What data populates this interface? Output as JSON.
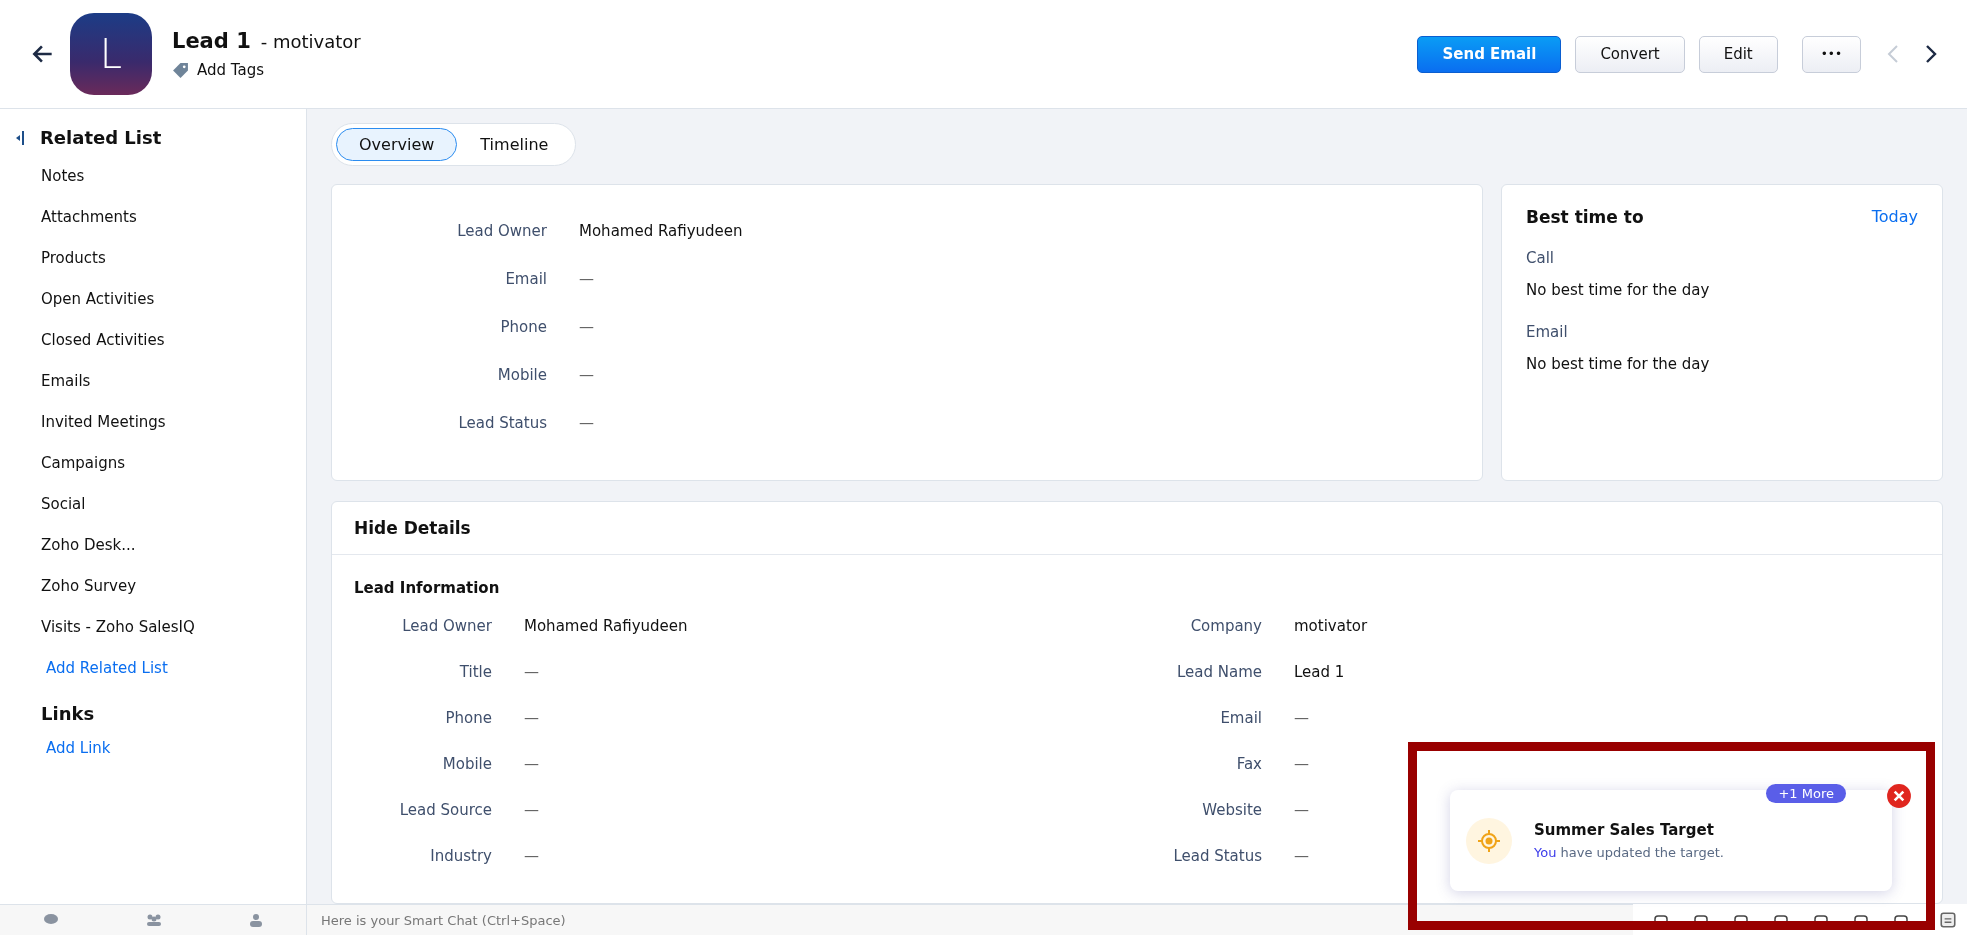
{
  "header": {
    "avatar_letter": "L",
    "title": "Lead 1",
    "subtitle": "- motivator",
    "add_tags": "Add Tags",
    "buttons": [
      {
        "label": "Send Email",
        "kind": "primary"
      },
      {
        "label": "Convert",
        "kind": "plain"
      },
      {
        "label": "Edit",
        "kind": "plain"
      }
    ],
    "more": "•••",
    "prev_disabled": true,
    "next_disabled": false
  },
  "sidebar": {
    "title": "Related List",
    "items": [
      "Notes",
      "Attachments",
      "Products",
      "Open Activities",
      "Closed Activities",
      "Emails",
      "Invited Meetings",
      "Campaigns",
      "Social",
      "Zoho Desk...",
      "Zoho Survey",
      "Visits - Zoho SalesIQ"
    ],
    "add_related": "Add Related List",
    "links_title": "Links",
    "add_link": "Add Link"
  },
  "tabs": [
    {
      "label": "Overview",
      "selected": true
    },
    {
      "label": "Timeline",
      "selected": false
    }
  ],
  "overview": {
    "fields": [
      {
        "label": "Lead Owner",
        "value": "Mohamed Rafiyudeen"
      },
      {
        "label": "Email",
        "value": "—"
      },
      {
        "label": "Phone",
        "value": "—"
      },
      {
        "label": "Mobile",
        "value": "—"
      },
      {
        "label": "Lead Status",
        "value": "—"
      }
    ]
  },
  "best_time": {
    "title": "Best time to",
    "link": "Today",
    "sections": [
      {
        "label": "Call",
        "value": "No best time for the day"
      },
      {
        "label": "Email",
        "value": "No best time for the day"
      }
    ]
  },
  "details": {
    "toggle": "Hide Details",
    "section": "Lead Information",
    "rows": [
      {
        "left_label": "Lead Owner",
        "left_value": "Mohamed Rafiyudeen",
        "right_label": "Company",
        "right_value": "motivator"
      },
      {
        "left_label": "Title",
        "left_value": "—",
        "right_label": "Lead Name",
        "right_value": "Lead 1"
      },
      {
        "left_label": "Phone",
        "left_value": "—",
        "right_label": "Email",
        "right_value": "—"
      },
      {
        "left_label": "Mobile",
        "left_value": "—",
        "right_label": "Fax",
        "right_value": "—"
      },
      {
        "left_label": "Lead Source",
        "left_value": "—",
        "right_label": "Website",
        "right_value": "—"
      },
      {
        "left_label": "Industry",
        "left_value": "—",
        "right_label": "Lead Status",
        "right_value": "—"
      }
    ]
  },
  "chat_bar": {
    "placeholder": "Here is your Smart Chat (Ctrl+Space)"
  },
  "notification": {
    "badge": "+1 More",
    "title": "Summer Sales Target",
    "actor": "You",
    "message": "have updated the target."
  }
}
